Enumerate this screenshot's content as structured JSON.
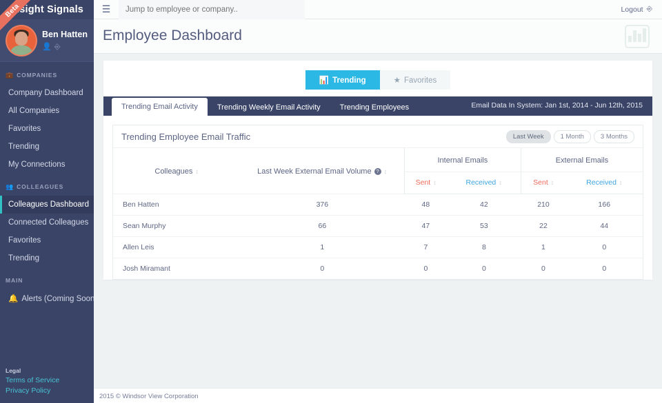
{
  "brand": {
    "name": "Insight Signals",
    "ribbon": "Beta"
  },
  "profile": {
    "name": "Ben Hatten",
    "icons": [
      "user-icon",
      "logout-icon"
    ]
  },
  "sidebar": {
    "groups": [
      {
        "label": "COMPANIES",
        "icon": "briefcase-icon",
        "items": [
          {
            "label": "Company Dashboard",
            "active": false
          },
          {
            "label": "All Companies",
            "active": false
          },
          {
            "label": "Favorites",
            "active": false
          },
          {
            "label": "Trending",
            "active": false
          },
          {
            "label": "My Connections",
            "active": false
          }
        ]
      },
      {
        "label": "COLLEAGUES",
        "icon": "people-icon",
        "items": [
          {
            "label": "Colleagues Dashboard",
            "active": true
          },
          {
            "label": "Connected Colleagues",
            "active": false
          },
          {
            "label": "Favorites",
            "active": false
          },
          {
            "label": "Trending",
            "active": false
          }
        ]
      },
      {
        "label": "MAIN",
        "icon": "",
        "items": [
          {
            "label": "Alerts (Coming Soon!)",
            "active": false,
            "icon": "bell-icon"
          }
        ]
      }
    ],
    "footer": {
      "legal_label": "Legal",
      "links": [
        "Terms of Service",
        "Privacy Policy"
      ]
    }
  },
  "topbar": {
    "menu_icon": "hamburger-icon",
    "search_placeholder": "Jump to employee or company..",
    "search_value": "",
    "logout_label": "Logout",
    "logout_icon": "sign-out-icon"
  },
  "page": {
    "title": "Employee Dashboard",
    "header_icon": "bar-chart-icon"
  },
  "view_toggle": {
    "trending": {
      "label": "Trending",
      "icon": "bar-chart-icon",
      "active": true
    },
    "favorites": {
      "label": "Favorites",
      "icon": "star-icon",
      "active": false
    }
  },
  "tabs": [
    {
      "label": "Trending Email Activity",
      "active": true
    },
    {
      "label": "Trending Weekly Email Activity",
      "active": false
    },
    {
      "label": "Trending Employees",
      "active": false
    }
  ],
  "data_range_note": "Email Data In System: Jan 1st, 2014 - Jun 12th, 2015",
  "panel": {
    "title": "Trending Employee Email Traffic",
    "range_pills": [
      {
        "label": "Last Week",
        "active": true
      },
      {
        "label": "1 Month",
        "active": false
      },
      {
        "label": "3 Months",
        "active": false
      }
    ]
  },
  "table": {
    "group_headers": {
      "colleagues": "Colleagues",
      "volume": "Last Week External Email Volume",
      "volume_help": "?",
      "internal": "Internal Emails",
      "external": "External Emails"
    },
    "sub_headers": {
      "internal_sent": "Sent",
      "internal_received": "Received",
      "external_sent": "Sent",
      "external_received": "Received"
    },
    "rows": [
      {
        "name": "Ben Hatten",
        "volume": "376",
        "internal_sent": "48",
        "internal_received": "42",
        "external_sent": "210",
        "external_received": "166"
      },
      {
        "name": "Sean Murphy",
        "volume": "66",
        "internal_sent": "47",
        "internal_received": "53",
        "external_sent": "22",
        "external_received": "44"
      },
      {
        "name": "Allen Leis",
        "volume": "1",
        "internal_sent": "7",
        "internal_received": "8",
        "external_sent": "1",
        "external_received": "0"
      },
      {
        "name": "Josh Miramant",
        "volume": "0",
        "internal_sent": "0",
        "internal_received": "0",
        "external_sent": "0",
        "external_received": "0"
      }
    ]
  },
  "footer": {
    "copyright": "2015 © Windsor View Corporation"
  },
  "colors": {
    "sidebar": "#3a4466",
    "accent_cyan": "#2cb8e5",
    "accent_teal": "#31c0c4",
    "sent_red": "#ef6a5a",
    "received_blue": "#3ea4e0",
    "avatar_orange": "#e8623c",
    "beta_red": "#e8705f"
  }
}
